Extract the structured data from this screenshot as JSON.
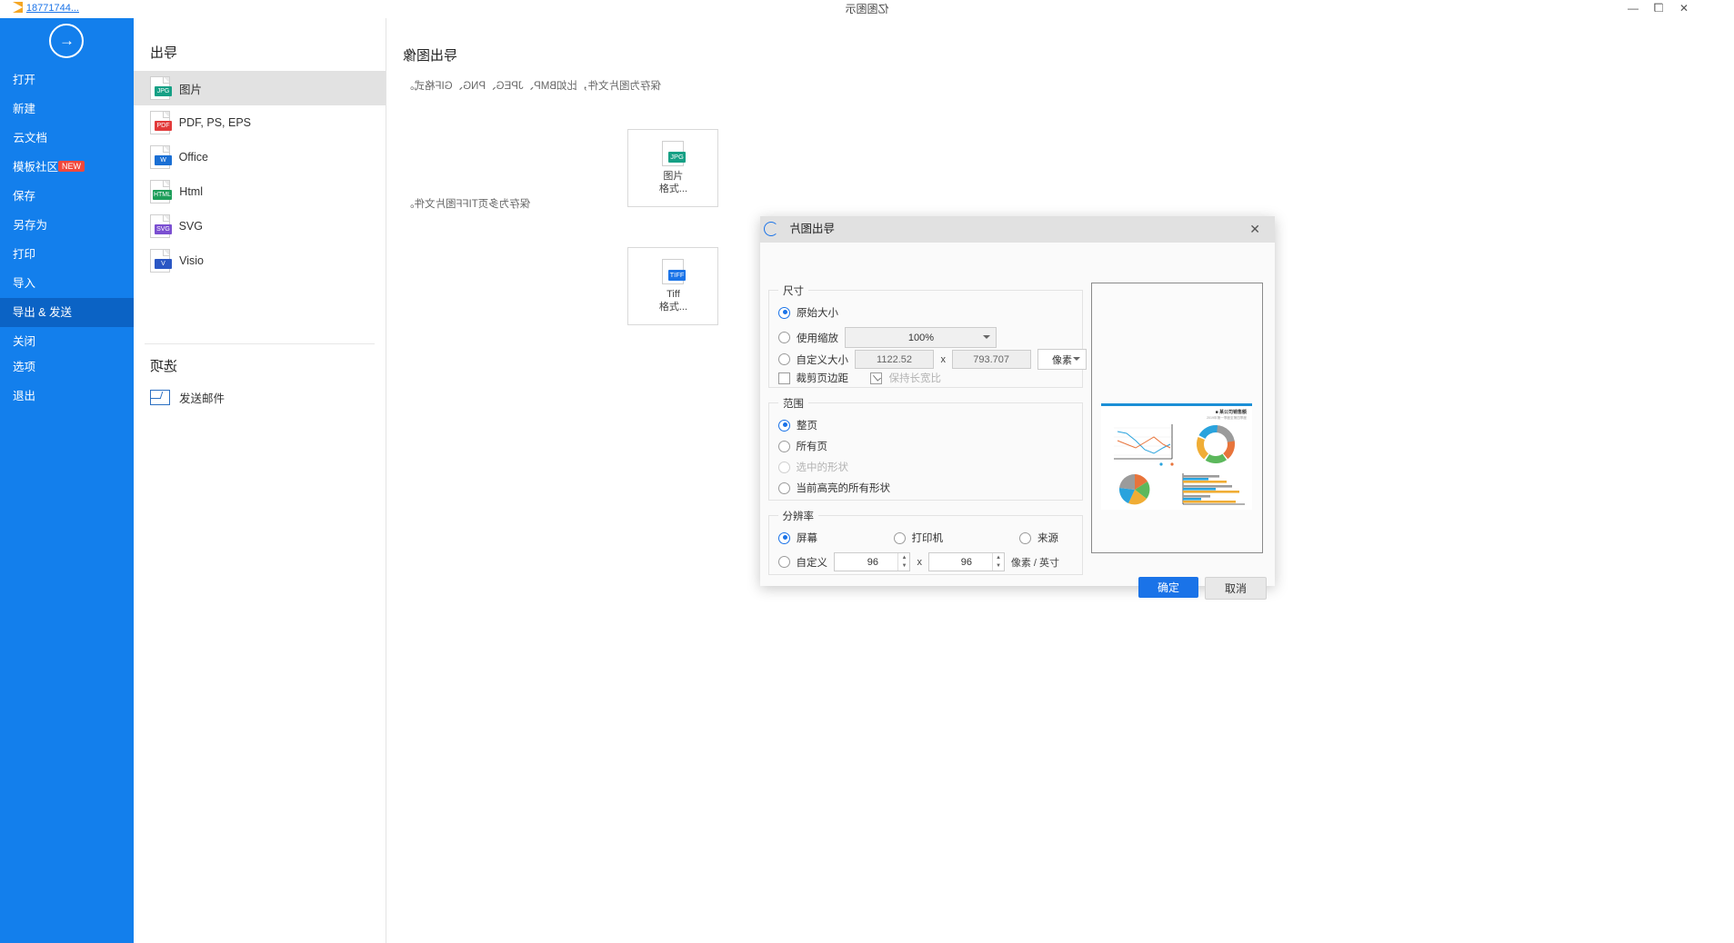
{
  "window": {
    "app_title": "亿图图示",
    "doc_tab_label": "18771744...",
    "minimize": "—",
    "restore": "❐",
    "close": "✕"
  },
  "backstage": {
    "rail_items": [
      {
        "label": "打开",
        "active": false,
        "badge": null
      },
      {
        "label": "新建",
        "active": false,
        "badge": null
      },
      {
        "label": "云文档",
        "active": false,
        "badge": null
      },
      {
        "label": "模板社区",
        "active": false,
        "badge": "NEW"
      },
      {
        "label": "保存",
        "active": false,
        "badge": null
      },
      {
        "label": "另存为",
        "active": false,
        "badge": null
      },
      {
        "label": "打印",
        "active": false,
        "badge": null
      },
      {
        "label": "导入",
        "active": false,
        "badge": null
      },
      {
        "label": "导出 & 发送",
        "active": true,
        "badge": null
      },
      {
        "label": "关闭",
        "active": false,
        "badge": null
      }
    ],
    "rail_bottom_items": [
      {
        "label": "选项"
      },
      {
        "label": "退出"
      }
    ],
    "back_arrow": "→"
  },
  "export_panel": {
    "heading": "导出",
    "formats": [
      {
        "label": "图片",
        "tag": "JPG",
        "tag_color": "#16a085",
        "selected": true
      },
      {
        "label": "PDF, PS, EPS",
        "tag": "PDF",
        "tag_color": "#e23a3a",
        "selected": false
      },
      {
        "label": "Office",
        "tag": "W",
        "tag_color": "#1a6fd4",
        "selected": false
      },
      {
        "label": "Html",
        "tag": "HTML",
        "tag_color": "#1e9e5a",
        "selected": false
      },
      {
        "label": "SVG",
        "tag": "SVG",
        "tag_color": "#7b4fd1",
        "selected": false
      },
      {
        "label": "Visio",
        "tag": "V",
        "tag_color": "#2b57c4",
        "selected": false
      }
    ],
    "options_heading": "选项",
    "send_mail_label": "发送邮件"
  },
  "export_image_pane": {
    "heading": "导出图像",
    "desc_1": "保存为图片文件，比如BMP、JPEG、PNG、GIF格式。",
    "card_1": {
      "tag": "JPG",
      "tag_color": "#16a085",
      "line1": "图片",
      "line2": "格式..."
    },
    "desc_2": "保存为多页TIFF图片文件。",
    "card_2": {
      "tag": "TIFF",
      "tag_color": "#1a73e8",
      "line1": "Tiff",
      "line2": "格式..."
    }
  },
  "dialog": {
    "title": "导出图片",
    "close_glyph": "✕",
    "size_group": {
      "label": "尺寸",
      "option_original": "原始大小",
      "option_zoom": "使用缩放",
      "zoom_value": "100%",
      "option_custom": "自定义大小",
      "width_value": "1122.52",
      "height_value": "793.707",
      "x_sep": "x",
      "unit_value": "像素",
      "keep_ratio_label": "保持长宽比",
      "crop_margin_label": "裁剪页边距"
    },
    "range_group": {
      "label": "范围",
      "options": [
        {
          "label": "整页",
          "selected": true,
          "disabled": false
        },
        {
          "label": "所有页",
          "selected": false,
          "disabled": false
        },
        {
          "label": "选中的形状",
          "selected": false,
          "disabled": true
        },
        {
          "label": "当前高亮的所有形状",
          "selected": false,
          "disabled": false
        }
      ]
    },
    "dpi_group": {
      "label": "分辨率",
      "options": [
        {
          "label": "屏幕",
          "selected": true
        },
        {
          "label": "打印机",
          "selected": false
        },
        {
          "label": "来源",
          "selected": false
        },
        {
          "label": "自定义",
          "selected": false
        }
      ],
      "dpi_x": "96",
      "dpi_y": "96",
      "x_sep": "x",
      "unit": "像素 / 英寸"
    },
    "buttons": {
      "ok": "确定",
      "cancel": "取消"
    },
    "preview": {
      "chart_title": "■ 某公司销售额",
      "chart_subtitle": "2019年第一季度至第四季度"
    }
  }
}
